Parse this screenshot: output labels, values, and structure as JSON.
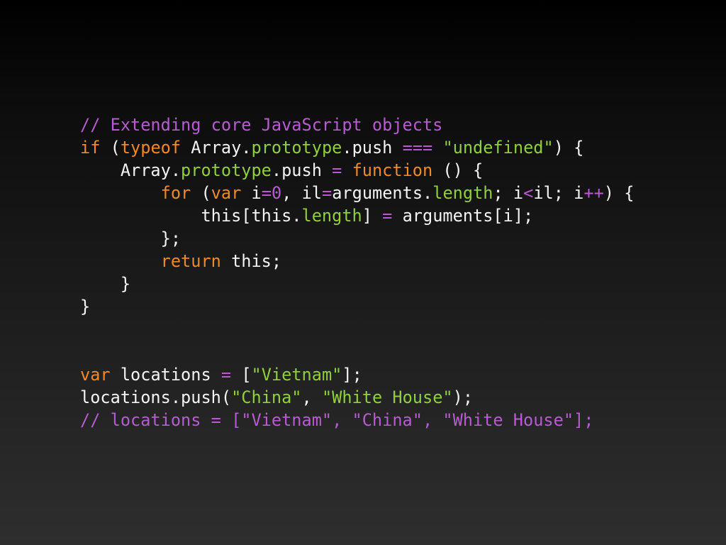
{
  "colors": {
    "default": "#f4f4f4",
    "comment": "#b85bd3",
    "keyword": "#f08a24",
    "property": "#8fd13c",
    "string": "#8fd13c",
    "operator": "#b85bd3",
    "number": "#b85bd3"
  },
  "code": {
    "lines": [
      {
        "indent": 0,
        "tokens": [
          {
            "t": "// Extending core JavaScript objects",
            "c": "comment"
          }
        ]
      },
      {
        "indent": 0,
        "tokens": [
          {
            "t": "if",
            "c": "keyword"
          },
          {
            "t": " (",
            "c": "default"
          },
          {
            "t": "typeof",
            "c": "keyword"
          },
          {
            "t": " Array.",
            "c": "default"
          },
          {
            "t": "prototype",
            "c": "property"
          },
          {
            "t": ".push ",
            "c": "default"
          },
          {
            "t": "===",
            "c": "operator"
          },
          {
            "t": " ",
            "c": "default"
          },
          {
            "t": "\"undefined\"",
            "c": "string"
          },
          {
            "t": ") {",
            "c": "default"
          }
        ]
      },
      {
        "indent": 4,
        "tokens": [
          {
            "t": "Array.",
            "c": "default"
          },
          {
            "t": "prototype",
            "c": "property"
          },
          {
            "t": ".push ",
            "c": "default"
          },
          {
            "t": "=",
            "c": "operator"
          },
          {
            "t": " ",
            "c": "default"
          },
          {
            "t": "function",
            "c": "keyword"
          },
          {
            "t": " () {",
            "c": "default"
          }
        ]
      },
      {
        "indent": 8,
        "tokens": [
          {
            "t": "for",
            "c": "keyword"
          },
          {
            "t": " (",
            "c": "default"
          },
          {
            "t": "var",
            "c": "keyword"
          },
          {
            "t": " i",
            "c": "default"
          },
          {
            "t": "=",
            "c": "operator"
          },
          {
            "t": "0",
            "c": "number"
          },
          {
            "t": ", il",
            "c": "default"
          },
          {
            "t": "=",
            "c": "operator"
          },
          {
            "t": "arguments.",
            "c": "default"
          },
          {
            "t": "length",
            "c": "property"
          },
          {
            "t": "; i",
            "c": "default"
          },
          {
            "t": "<",
            "c": "operator"
          },
          {
            "t": "il; i",
            "c": "default"
          },
          {
            "t": "++",
            "c": "operator"
          },
          {
            "t": ") {",
            "c": "default"
          }
        ]
      },
      {
        "indent": 12,
        "tokens": [
          {
            "t": "this[this.",
            "c": "default"
          },
          {
            "t": "length",
            "c": "property"
          },
          {
            "t": "] ",
            "c": "default"
          },
          {
            "t": "=",
            "c": "operator"
          },
          {
            "t": " arguments[i];",
            "c": "default"
          }
        ]
      },
      {
        "indent": 8,
        "tokens": [
          {
            "t": "};",
            "c": "default"
          }
        ]
      },
      {
        "indent": 8,
        "tokens": [
          {
            "t": "return",
            "c": "keyword"
          },
          {
            "t": " this;",
            "c": "default"
          }
        ]
      },
      {
        "indent": 4,
        "tokens": [
          {
            "t": "}",
            "c": "default"
          }
        ]
      },
      {
        "indent": 0,
        "tokens": [
          {
            "t": "}",
            "c": "default"
          }
        ]
      },
      {
        "indent": 0,
        "tokens": []
      },
      {
        "indent": 0,
        "tokens": []
      },
      {
        "indent": 0,
        "tokens": [
          {
            "t": "var",
            "c": "keyword"
          },
          {
            "t": " locations ",
            "c": "default"
          },
          {
            "t": "=",
            "c": "operator"
          },
          {
            "t": " [",
            "c": "default"
          },
          {
            "t": "\"Vietnam\"",
            "c": "string"
          },
          {
            "t": "];",
            "c": "default"
          }
        ]
      },
      {
        "indent": 0,
        "tokens": [
          {
            "t": "locations.push(",
            "c": "default"
          },
          {
            "t": "\"China\"",
            "c": "string"
          },
          {
            "t": ", ",
            "c": "default"
          },
          {
            "t": "\"White House\"",
            "c": "string"
          },
          {
            "t": ");",
            "c": "default"
          }
        ]
      },
      {
        "indent": 0,
        "tokens": [
          {
            "t": "// locations = [\"Vietnam\", \"China\", \"White House\"];",
            "c": "comment"
          }
        ]
      }
    ]
  }
}
